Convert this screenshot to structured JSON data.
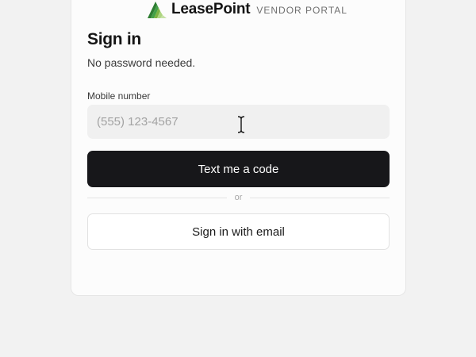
{
  "brand": {
    "name": "LeasePoint",
    "subtitle": "VENDOR PORTAL",
    "logo_icon": "stacked-triangle-logo",
    "logo_colors": [
      "#2f7d2f",
      "#4caf50",
      "#8bc34a",
      "#c5e1a5"
    ]
  },
  "signin": {
    "title": "Sign in",
    "subtitle": "No password needed."
  },
  "phone_field": {
    "label": "Mobile number",
    "placeholder": "(555) 123-4567",
    "value": ""
  },
  "actions": {
    "primary_label": "Text me a code",
    "divider_label": "or",
    "secondary_label": "Sign in with email"
  },
  "colors": {
    "primary_button": "#17171a",
    "background": "#f2f2f2",
    "card": "#fcfcfc"
  }
}
